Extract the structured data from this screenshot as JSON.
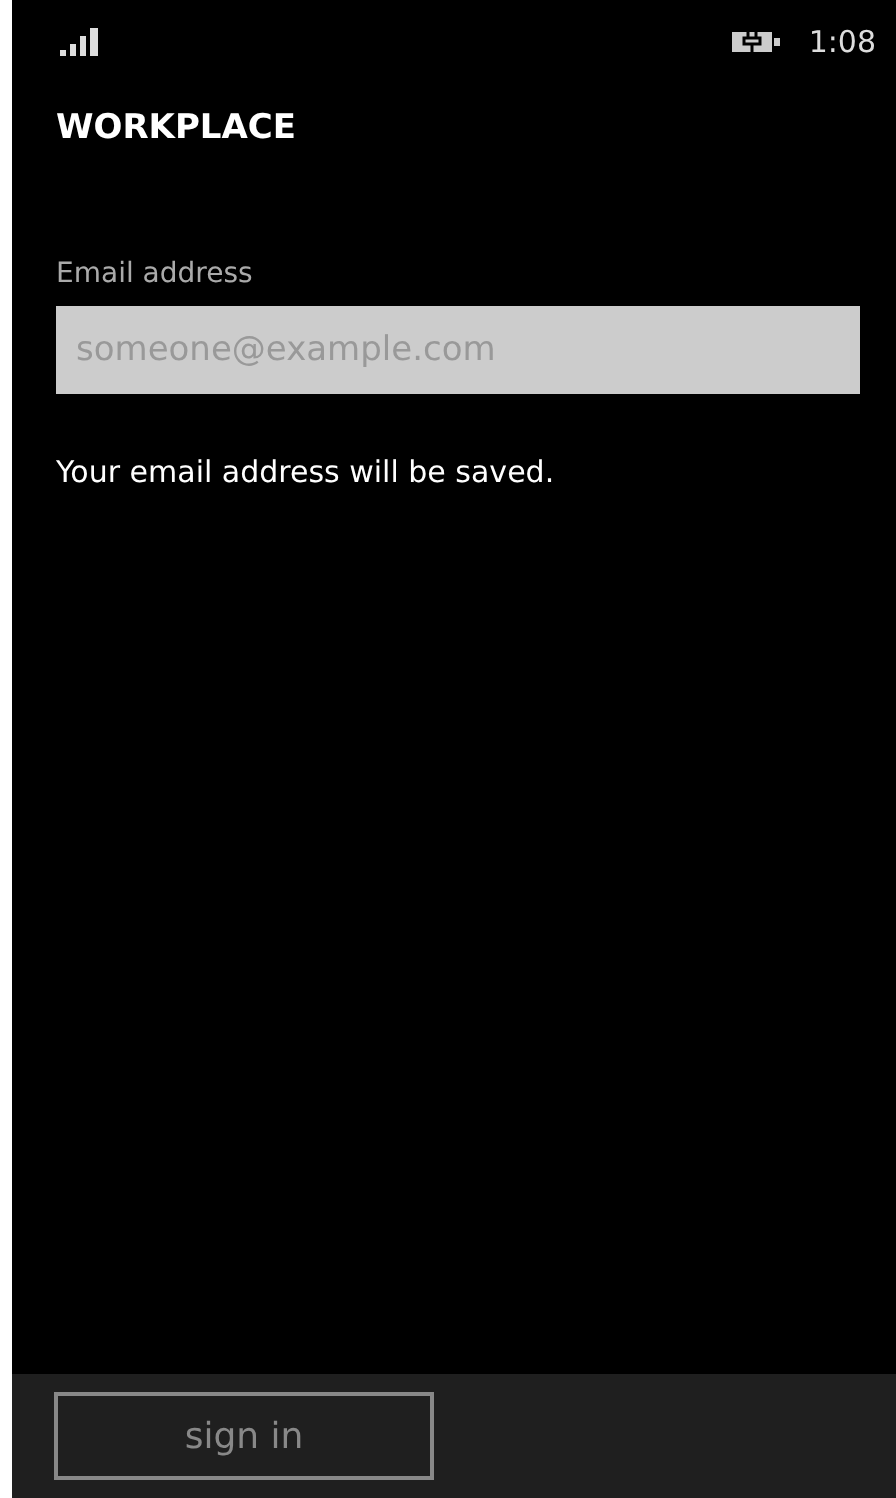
{
  "status_bar": {
    "time": "1:08"
  },
  "title": "WORKPLACE",
  "email_field": {
    "label": "Email address",
    "placeholder": "someone@example.com"
  },
  "note": "Your email address will be saved.",
  "app_bar": {
    "buttons": [
      {
        "label": "sign in",
        "disabled": true
      }
    ]
  }
}
